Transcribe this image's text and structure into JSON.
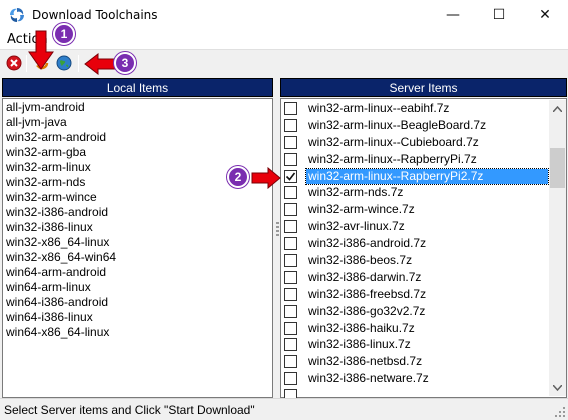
{
  "window": {
    "title": "Download Toolchains",
    "minimize": "—",
    "maximize": "☐",
    "close": "✕"
  },
  "menu": {
    "action": "Action"
  },
  "panels": {
    "local_header": "Local Items",
    "server_header": "Server Items"
  },
  "local_items": [
    "all-jvm-android",
    "all-jvm-java",
    "win32-arm-android",
    "win32-arm-gba",
    "win32-arm-linux",
    "win32-arm-nds",
    "win32-arm-wince",
    "win32-i386-android",
    "win32-i386-linux",
    "win32-x86_64-linux",
    "win32-x86_64-win64",
    "win64-arm-android",
    "win64-arm-linux",
    "win64-i386-android",
    "win64-i386-linux",
    "win64-x86_64-linux"
  ],
  "server_items": [
    {
      "label": "win32-arm-linux--eabihf.7z",
      "checked": false,
      "selected": false
    },
    {
      "label": "win32-arm-linux--BeagleBoard.7z",
      "checked": false,
      "selected": false
    },
    {
      "label": "win32-arm-linux--Cubieboard.7z",
      "checked": false,
      "selected": false
    },
    {
      "label": "win32-arm-linux--RapberryPi.7z",
      "checked": false,
      "selected": false
    },
    {
      "label": "win32-arm-linux--RapberryPi2.7z",
      "checked": true,
      "selected": true
    },
    {
      "label": "win32-arm-nds.7z",
      "checked": false,
      "selected": false
    },
    {
      "label": "win32-arm-wince.7z",
      "checked": false,
      "selected": false
    },
    {
      "label": "win32-avr-linux.7z",
      "checked": false,
      "selected": false
    },
    {
      "label": "win32-i386-android.7z",
      "checked": false,
      "selected": false
    },
    {
      "label": "win32-i386-beos.7z",
      "checked": false,
      "selected": false
    },
    {
      "label": "win32-i386-darwin.7z",
      "checked": false,
      "selected": false
    },
    {
      "label": "win32-i386-freebsd.7z",
      "checked": false,
      "selected": false
    },
    {
      "label": "win32-i386-go32v2.7z",
      "checked": false,
      "selected": false
    },
    {
      "label": "win32-i386-haiku.7z",
      "checked": false,
      "selected": false
    },
    {
      "label": "win32-i386-linux.7z",
      "checked": false,
      "selected": false
    },
    {
      "label": "win32-i386-netbsd.7z",
      "checked": false,
      "selected": false
    },
    {
      "label": "win32-i386-netware.7z",
      "checked": false,
      "selected": false
    },
    {
      "label": "",
      "checked": false,
      "selected": false
    }
  ],
  "status": "Select Server items and Click \"Start Download\"",
  "annotations": {
    "one": "1",
    "two": "2",
    "three": "3"
  },
  "colors": {
    "header_bg": "#0a246a",
    "selection": "#3399ff",
    "badge": "#7a2db0",
    "arrow": "#e8000b"
  },
  "icons": {
    "app": "app-swirl-icon",
    "stop": "stop-red-x-icon",
    "refresh": "refresh-icon",
    "globe": "globe-icon"
  }
}
